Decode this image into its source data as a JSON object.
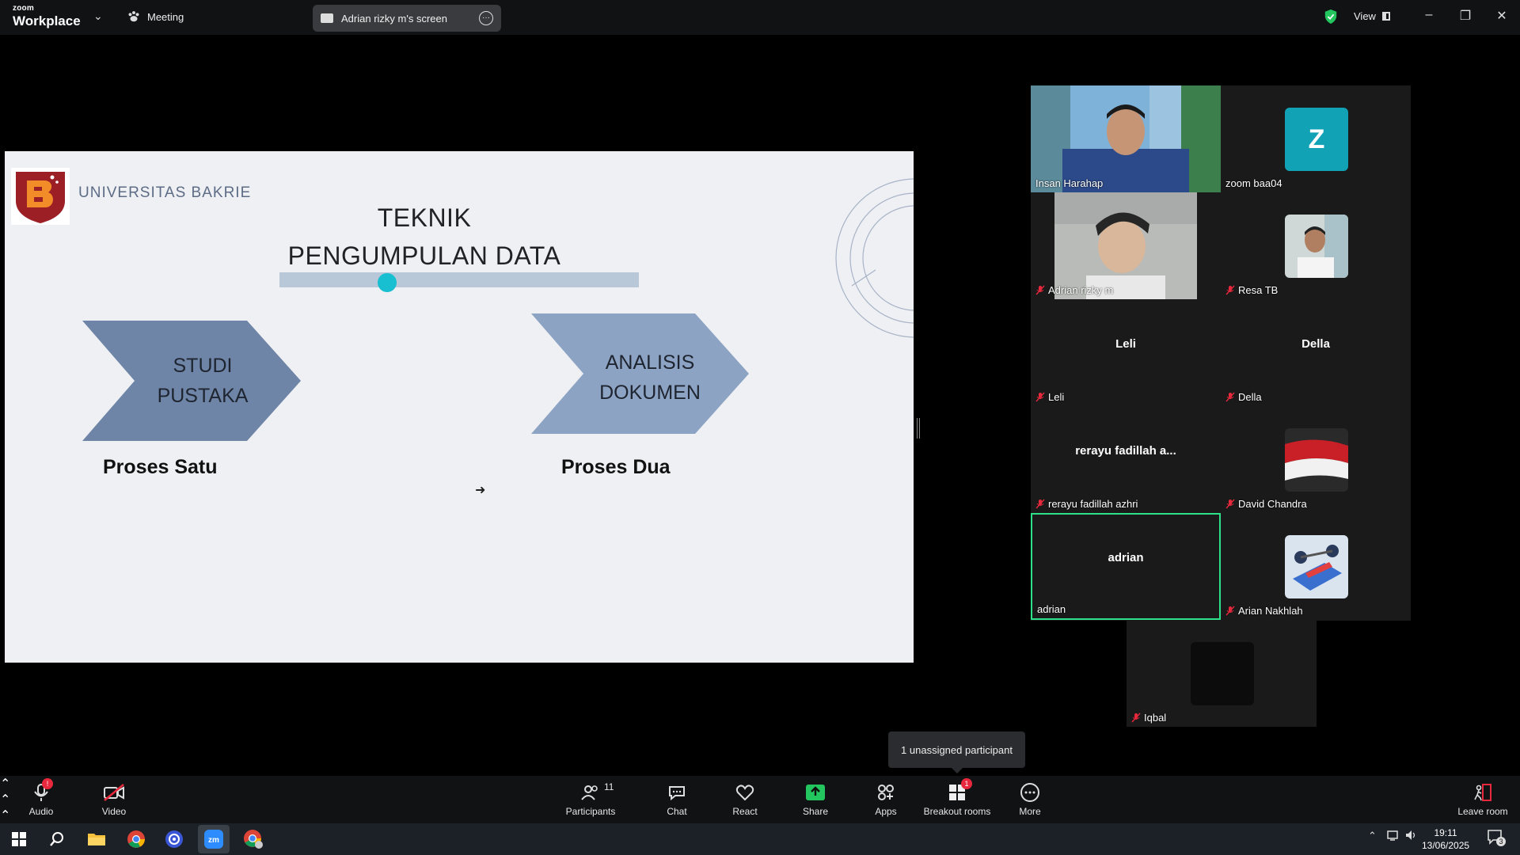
{
  "topbar": {
    "brand_small": "zoom",
    "brand_big": "Workplace",
    "meeting_label": "Meeting",
    "share_label": "Adrian rizky m's screen",
    "view_label": "View"
  },
  "slide": {
    "university": "UNIVERSITAS BAKRIE",
    "title_line1": "TEKNIK",
    "title_line2": "PENGUMPULAN DATA",
    "arrow1_line1": "STUDI",
    "arrow1_line2": "PUSTAKA",
    "arrow2_line1": "ANALISIS",
    "arrow2_line2": "DOKUMEN",
    "process1": "Proses Satu",
    "process2": "Proses Dua",
    "colors": {
      "arrow1": "#6e85a7",
      "arrow2": "#8da3c3",
      "accent": "#18bfd0"
    }
  },
  "participants": [
    {
      "name": "Insan Harahap",
      "muted": false,
      "type": "video"
    },
    {
      "name": "zoom baa04",
      "muted": false,
      "type": "letter",
      "letter": "Z"
    },
    {
      "name": "Adrian rizky m",
      "muted": true,
      "type": "video"
    },
    {
      "name": "Resa TB",
      "muted": true,
      "type": "photo"
    },
    {
      "name": "Leli",
      "muted": true,
      "type": "name",
      "display": "Leli"
    },
    {
      "name": "Della",
      "muted": true,
      "type": "name",
      "display": "Della"
    },
    {
      "name": "rerayu fadillah azhri",
      "muted": true,
      "type": "name",
      "display": "rerayu fadillah a..."
    },
    {
      "name": "David Chandra",
      "muted": true,
      "type": "photo"
    },
    {
      "name": "adrian",
      "muted": false,
      "type": "name",
      "display": "adrian",
      "active": true
    },
    {
      "name": "Arian Nakhlah",
      "muted": true,
      "type": "photo"
    },
    {
      "name": "Iqbal",
      "muted": true,
      "type": "blank"
    }
  ],
  "tooltip": "1 unassigned participant",
  "toolbar": {
    "audio": "Audio",
    "video": "Video",
    "participants": "Participants",
    "participants_count": "11",
    "chat": "Chat",
    "react": "React",
    "share": "Share",
    "apps": "Apps",
    "breakout": "Breakout rooms",
    "breakout_badge": "1",
    "more": "More",
    "leave": "Leave room"
  },
  "taskbar": {
    "time": "19:11",
    "date": "13/06/2025",
    "notif_count": "3"
  }
}
